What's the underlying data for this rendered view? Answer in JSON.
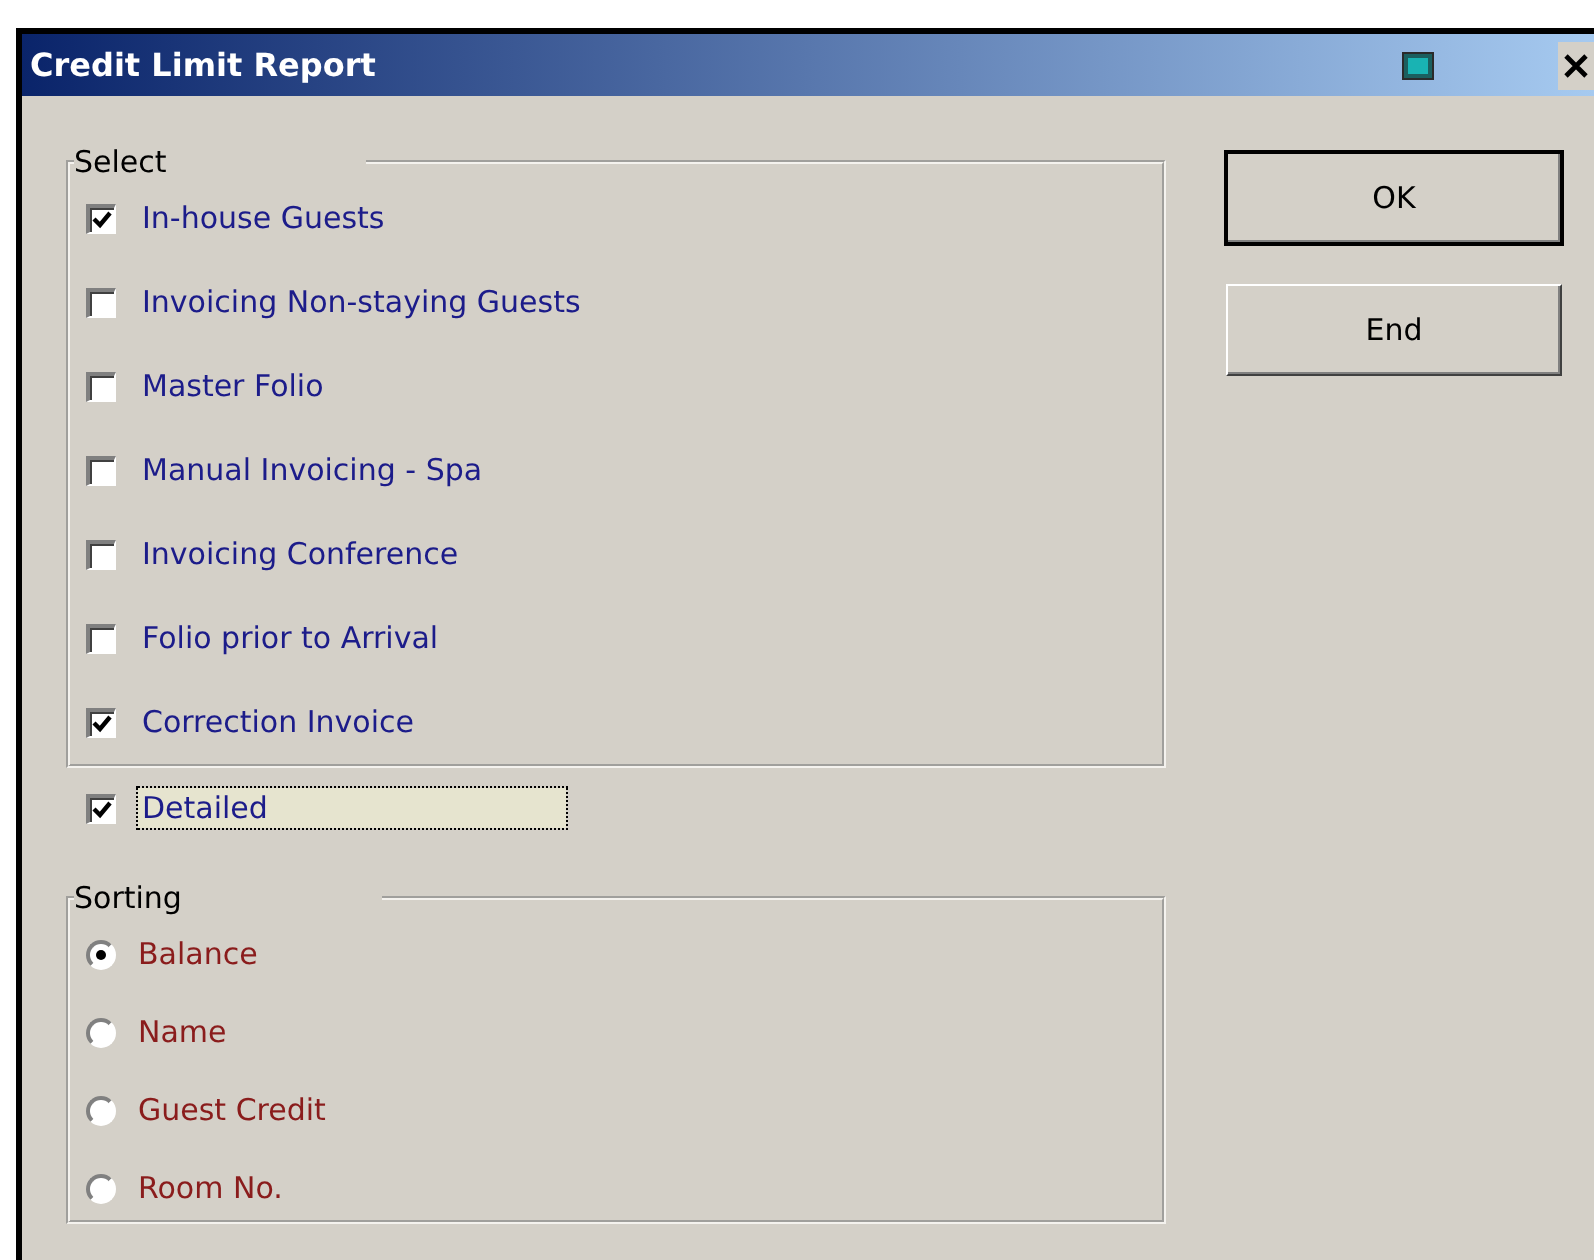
{
  "window": {
    "title": "Credit Limit Report"
  },
  "select_group": {
    "legend": "Select",
    "items": [
      {
        "label": "In-house Guests",
        "checked": true
      },
      {
        "label": "Invoicing Non-staying Guests",
        "checked": false
      },
      {
        "label": "Master Folio",
        "checked": false
      },
      {
        "label": "Manual Invoicing - Spa",
        "checked": false
      },
      {
        "label": "Invoicing Conference",
        "checked": false
      },
      {
        "label": "Folio prior to Arrival",
        "checked": false
      },
      {
        "label": "Correction Invoice",
        "checked": true
      }
    ]
  },
  "detailed": {
    "label": "Detailed",
    "checked": true,
    "focused": true
  },
  "sorting_group": {
    "legend": "Sorting",
    "options": [
      {
        "label": "Balance",
        "selected": true
      },
      {
        "label": "Name",
        "selected": false
      },
      {
        "label": "Guest Credit",
        "selected": false
      },
      {
        "label": "Room No.",
        "selected": false
      }
    ]
  },
  "buttons": [
    {
      "label": "OK",
      "default": true
    },
    {
      "label": "End",
      "default": false
    }
  ]
}
